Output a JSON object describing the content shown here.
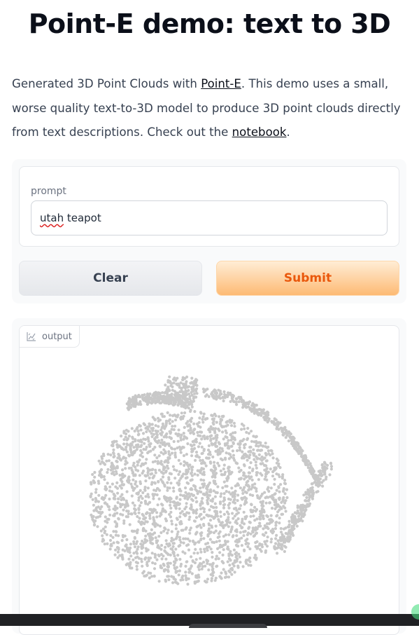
{
  "header": {
    "title": "Point-E demo: text to 3D"
  },
  "description": {
    "part1": "Generated 3D Point Clouds with ",
    "link1": "Point-E",
    "part2": ". This demo uses a small, worse quality text-to-3D model to produce 3D point clouds directly from text descriptions. Check out the ",
    "link2": "notebook",
    "part3": "."
  },
  "prompt": {
    "label": "prompt",
    "value_word1": "utah",
    "value_rest": " teapot"
  },
  "buttons": {
    "clear_label": "Clear",
    "submit_label": "Submit"
  },
  "output": {
    "label": "output",
    "icon": "chart-icon",
    "point_color": "#c8c8c8"
  },
  "colors": {
    "submit_text": "#ea580c",
    "title": "#0b0f19"
  }
}
